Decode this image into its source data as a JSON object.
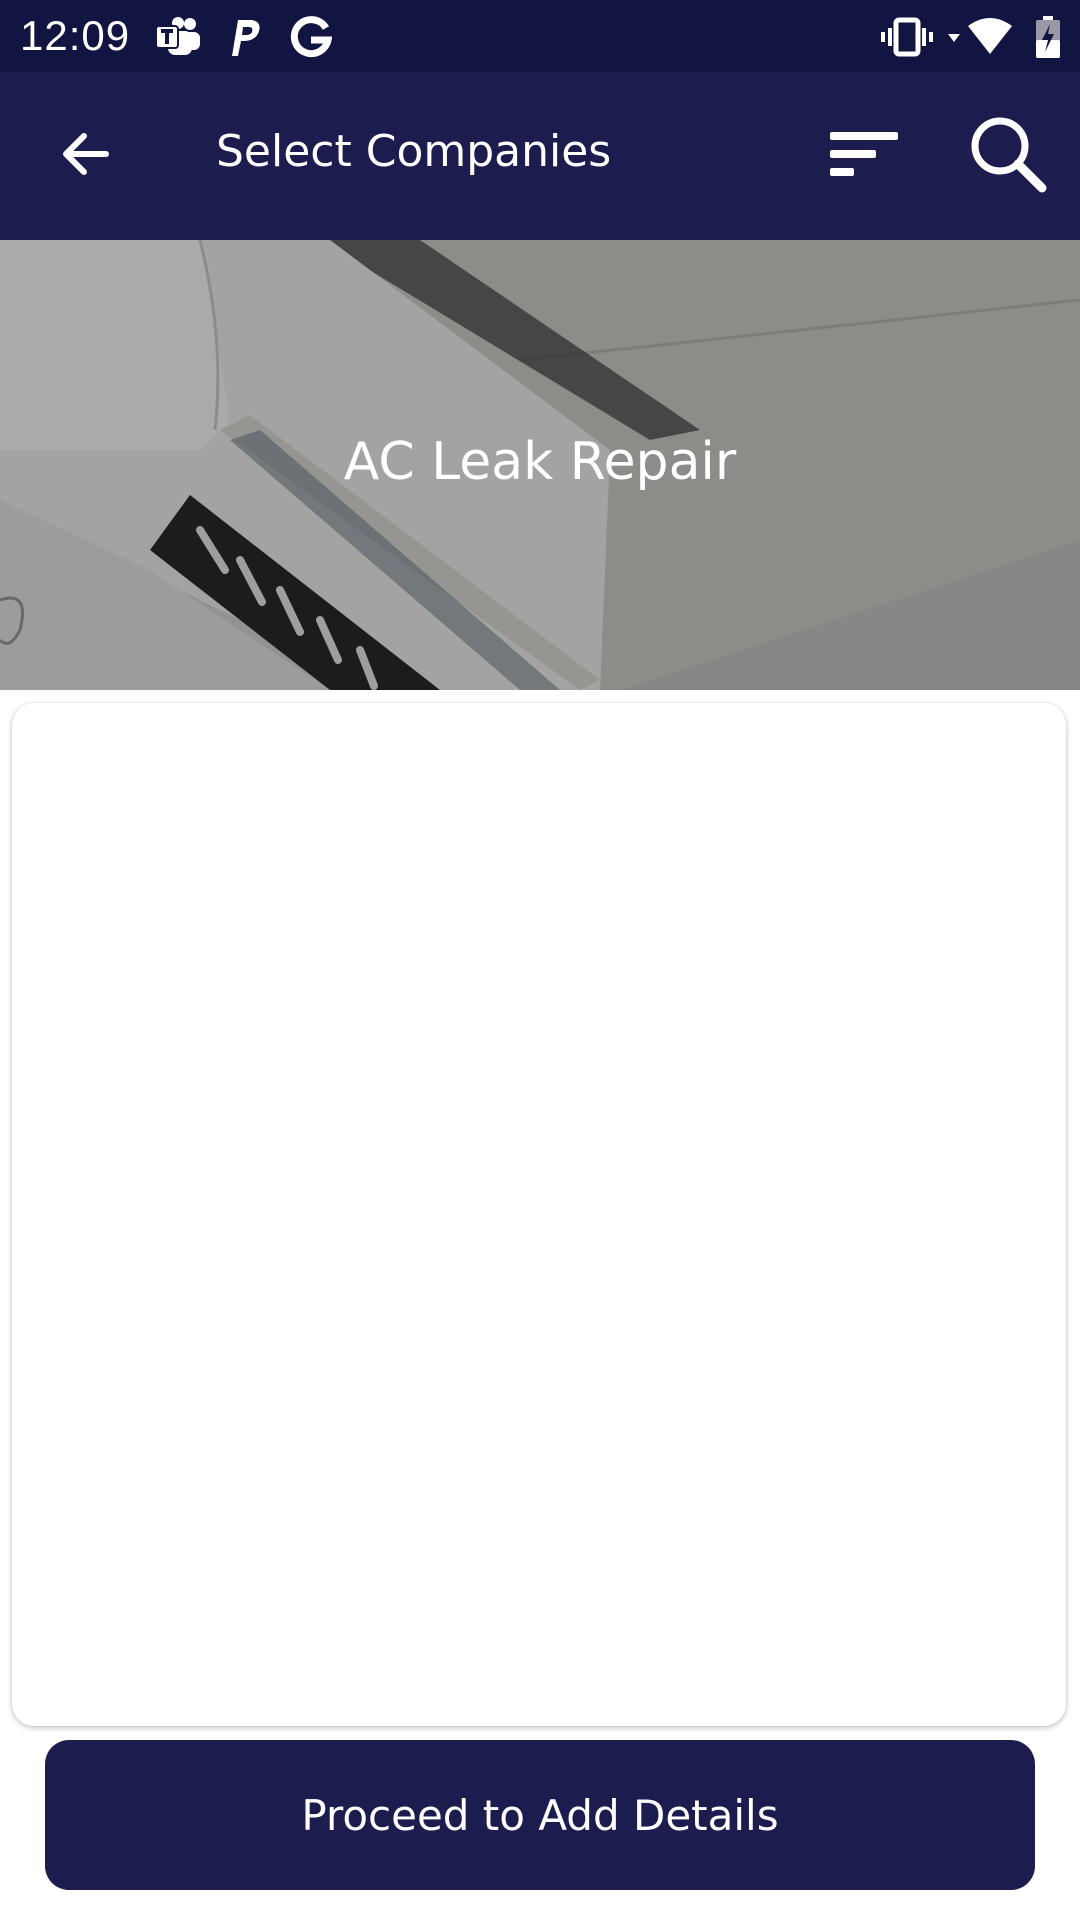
{
  "status_bar": {
    "time": "12:09",
    "left_icons": [
      "teams-icon",
      "paypal-icon",
      "google-icon"
    ],
    "right_icons": [
      "vibrate-icon",
      "wifi-icon",
      "battery-charging-icon"
    ]
  },
  "app_bar": {
    "title": "Select Companies",
    "back_icon": "arrow-back-icon",
    "filter_icon": "sort-filter-icon",
    "search_icon": "search-icon"
  },
  "hero": {
    "title": "AC Leak Repair",
    "image": "air-conditioner-photo"
  },
  "footer": {
    "proceed_label": "Proceed to Add Details"
  },
  "colors": {
    "status_bar": "#121542",
    "app_bar": "#1c1c4f",
    "primary_button": "#1c1c4f",
    "on_primary": "#ffffff"
  }
}
